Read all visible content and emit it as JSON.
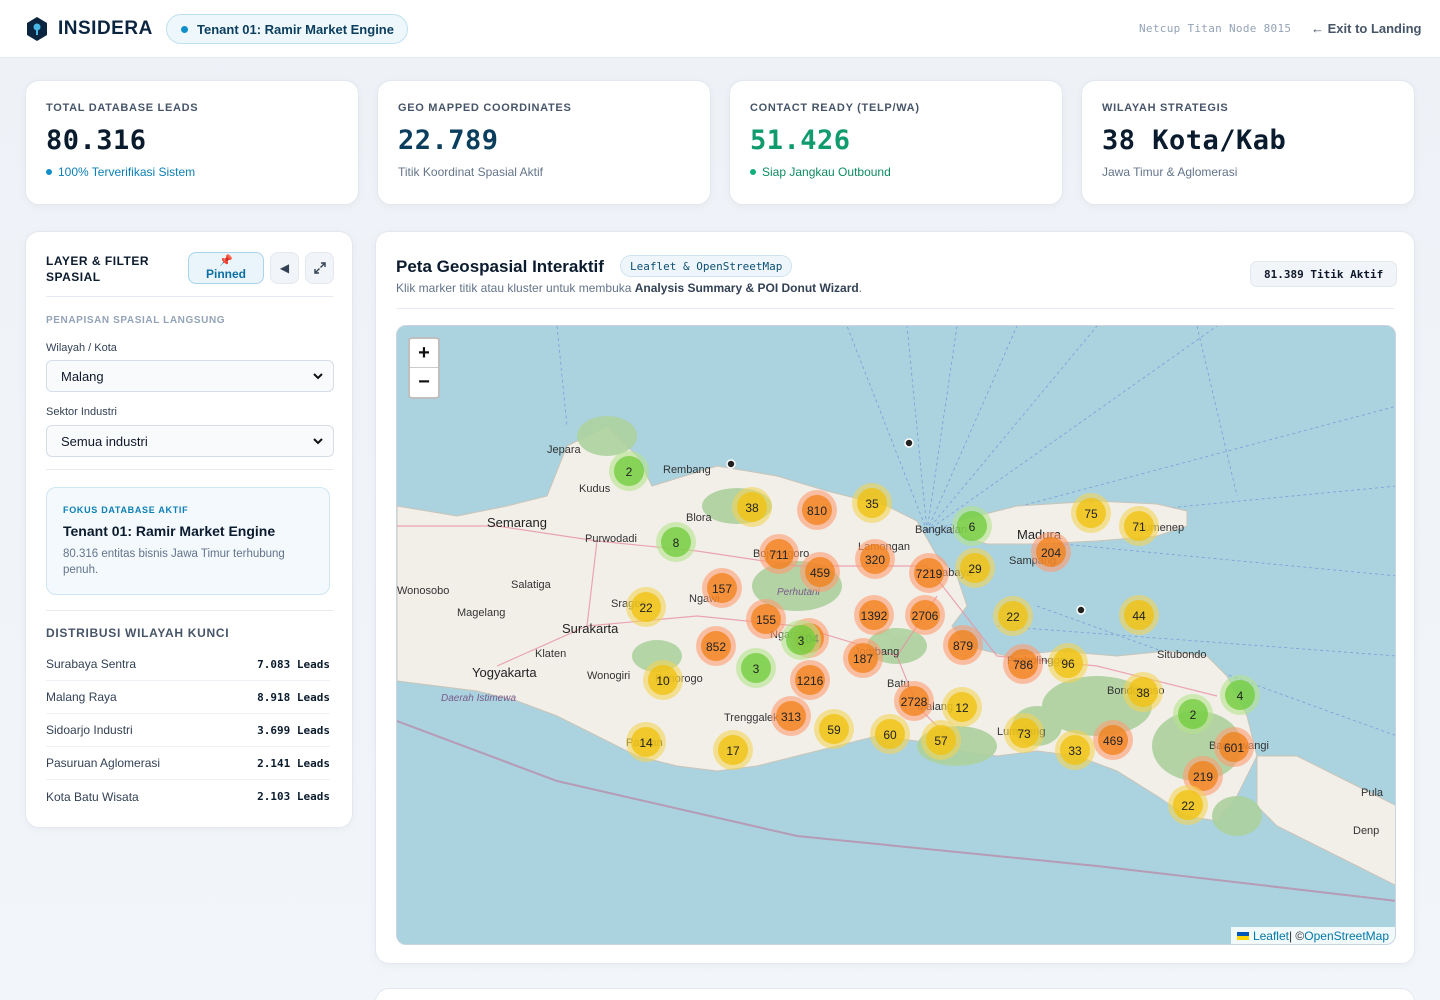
{
  "header": {
    "brand": "INSIDERA",
    "tenant": "Tenant 01: Ramir Market Engine",
    "node": "Netcup Titan Node 8015",
    "exit": "← Exit to Landing"
  },
  "kpis": [
    {
      "label": "TOTAL DATABASE LEADS",
      "value": "80.316",
      "sub": "100% Terverifikasi Sistem"
    },
    {
      "label": "GEO MAPPED COORDINATES",
      "value": "22.789",
      "sub": "Titik Koordinat Spasial Aktif"
    },
    {
      "label": "CONTACT READY (TELP/WA)",
      "value": "51.426",
      "sub": "Siap Jangkau Outbound"
    },
    {
      "label": "WILAYAH STRATEGIS",
      "value": "38 Kota/Kab",
      "sub": "Jawa Timur & Aglomerasi"
    }
  ],
  "panel": {
    "title": "LAYER & FILTER SPASIAL",
    "pinned": "Pinned",
    "section": "PENAPISAN SPASIAL LANGSUNG",
    "region_label": "Wilayah / Kota",
    "region_value": "Malang",
    "sector_label": "Sektor Industri",
    "sector_value": "Semua industri",
    "focus_label": "FOKUS DATABASE AKTIF",
    "focus_title": "Tenant 01: Ramir Market Engine",
    "focus_desc": "80.316 entitas bisnis Jawa Timur terhubung penuh.",
    "dist_title": "DISTRIBUSI WILAYAH KUNCI",
    "dist": [
      {
        "name": "Surabaya Sentra",
        "value": "7.083 Leads"
      },
      {
        "name": "Malang Raya",
        "value": "8.918 Leads"
      },
      {
        "name": "Sidoarjo Industri",
        "value": "3.699 Leads"
      },
      {
        "name": "Pasuruan Aglomerasi",
        "value": "2.141 Leads"
      },
      {
        "name": "Kota Batu Wisata",
        "value": "2.103 Leads"
      }
    ]
  },
  "map": {
    "title": "Peta Geospasial Interaktif",
    "chip": "Leaflet & OpenStreetMap",
    "hint_pre": "Klik marker titik atau kluster untuk membuka ",
    "hint_bold": "Analysis Summary & POI Donut Wizard",
    "hint_post": ".",
    "count": "81.389 Titik Aktif",
    "zoom_in": "+",
    "zoom_out": "−",
    "attr_leaflet": "Leaflet",
    "attr_sep": " | © ",
    "attr_osm": "OpenStreetMap",
    "places": [
      "Jepara",
      "Rembang",
      "Kudus",
      "Semarang",
      "Blora",
      "Purwodadi",
      "Bangkalan",
      "Madura",
      "Sampang",
      "Sumenep",
      "Lamongan",
      "Surabaya",
      "Wonosobo",
      "Salatiga",
      "Magelang",
      "Sragen",
      "Ngawi",
      "Perhutani",
      "Surakarta",
      "Jombang",
      "Klaten",
      "Wonogiri",
      "Yogyakarta",
      "Daerah Istimewa",
      "Ponorogo",
      "Trenggalek",
      "Batu",
      "Malang",
      "Lumajang",
      "Probolinggo",
      "Situbondo",
      "Bondowoso",
      "Banyuwangi",
      "Bojonegoro",
      "Nganjuk",
      "Pacitan",
      "Pula",
      "Denp"
    ],
    "clusters": [
      {
        "label": "2",
        "level": "green"
      },
      {
        "label": "38",
        "level": "yellow"
      },
      {
        "label": "810",
        "level": "orange"
      },
      {
        "label": "35",
        "level": "yellow"
      },
      {
        "label": "8",
        "level": "green"
      },
      {
        "label": "711",
        "level": "orange"
      },
      {
        "label": "459",
        "level": "orange"
      },
      {
        "label": "320",
        "level": "orange"
      },
      {
        "label": "7219",
        "level": "orange"
      },
      {
        "label": "6",
        "level": "green"
      },
      {
        "label": "29",
        "level": "yellow"
      },
      {
        "label": "75",
        "level": "yellow"
      },
      {
        "label": "71",
        "level": "yellow"
      },
      {
        "label": "204",
        "level": "orange"
      },
      {
        "label": "157",
        "level": "orange"
      },
      {
        "label": "22",
        "level": "yellow"
      },
      {
        "label": "155",
        "level": "orange"
      },
      {
        "label": "1392",
        "level": "orange"
      },
      {
        "label": "2706",
        "level": "orange"
      },
      {
        "label": "22",
        "level": "yellow"
      },
      {
        "label": "852",
        "level": "orange"
      },
      {
        "label": "104",
        "level": "orange"
      },
      {
        "label": "879",
        "level": "orange"
      },
      {
        "label": "3",
        "level": "green"
      },
      {
        "label": "44",
        "level": "yellow"
      },
      {
        "label": "3",
        "level": "green"
      },
      {
        "label": "187",
        "level": "orange"
      },
      {
        "label": "786",
        "level": "orange"
      },
      {
        "label": "96",
        "level": "yellow"
      },
      {
        "label": "10",
        "level": "yellow"
      },
      {
        "label": "1216",
        "level": "orange"
      },
      {
        "label": "38",
        "level": "yellow"
      },
      {
        "label": "4",
        "level": "green"
      },
      {
        "label": "2728",
        "level": "orange"
      },
      {
        "label": "12",
        "level": "yellow"
      },
      {
        "label": "313",
        "level": "orange"
      },
      {
        "label": "2",
        "level": "green"
      },
      {
        "label": "73",
        "level": "yellow"
      },
      {
        "label": "59",
        "level": "yellow"
      },
      {
        "label": "60",
        "level": "yellow"
      },
      {
        "label": "57",
        "level": "yellow"
      },
      {
        "label": "469",
        "level": "orange"
      },
      {
        "label": "601",
        "level": "orange"
      },
      {
        "label": "14",
        "level": "yellow"
      },
      {
        "label": "17",
        "level": "yellow"
      },
      {
        "label": "33",
        "level": "yellow"
      },
      {
        "label": "219",
        "level": "orange"
      },
      {
        "label": "22",
        "level": "yellow"
      }
    ]
  },
  "colors": {
    "accent": "#0f8fc9",
    "green_text": "#0f9b6e",
    "sea": "#aad3df",
    "land": "#f2efe9",
    "cluster_green": "#6ecc39",
    "cluster_yellow": "#f0c20c",
    "cluster_orange": "#f18017"
  }
}
